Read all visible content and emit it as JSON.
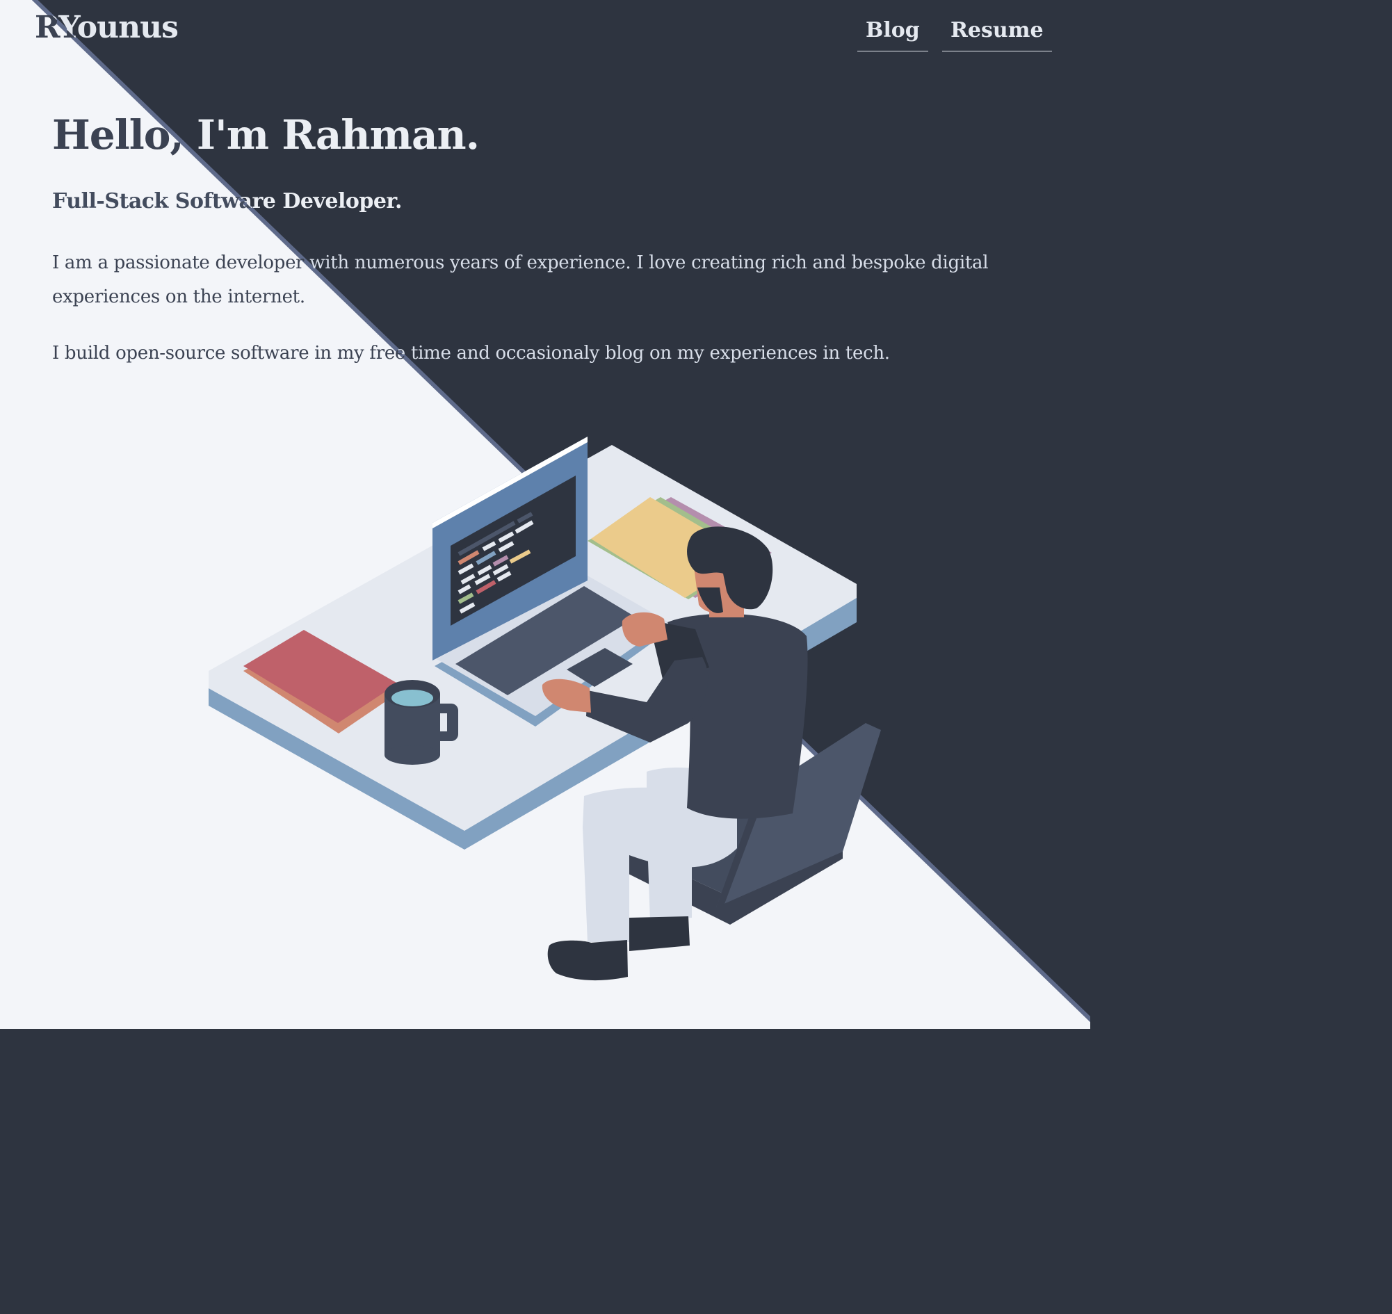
{
  "site": {
    "logo": "RYounus"
  },
  "nav": {
    "items": [
      {
        "label": "Blog"
      },
      {
        "label": "Resume"
      }
    ]
  },
  "hero": {
    "title": "Hello, I'm Rahman.",
    "subtitle": "Full-Stack Software Developer.",
    "paragraphs": [
      "I am a passionate developer with numerous years of experience. I love creating rich and bespoke digital experiences on the internet.",
      "I build open-source software in my free time and occasionaly blog on my experiences in tech."
    ]
  },
  "illustration": {
    "icon": "developer-at-desk-illustration"
  },
  "colors": {
    "dark_bg": "#2e3440",
    "light_bg": "#f3f5f9",
    "divider": "#5e6a8a",
    "text_dark": "#3b4252",
    "text_light": "#e5e9f0",
    "accent_blue": "#81a1c1",
    "accent_red": "#bf616a",
    "accent_yellow": "#ebcb8b"
  }
}
